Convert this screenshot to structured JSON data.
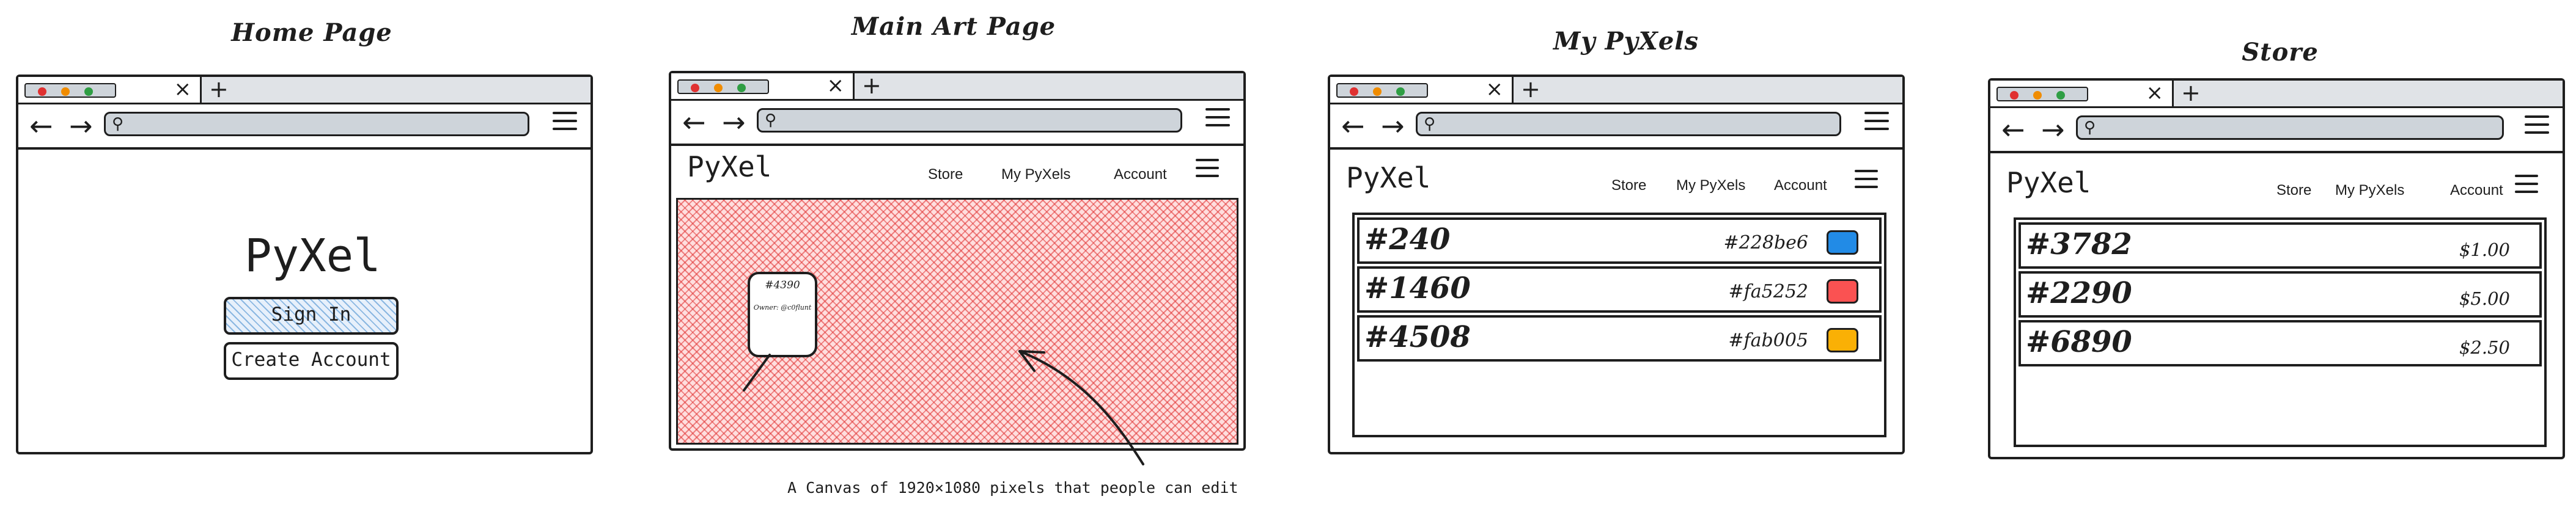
{
  "page_titles": {
    "home": "Home Page",
    "art": "Main Art Page",
    "mypyxels": "My PyXels",
    "store": "Store"
  },
  "brand": "PyXel",
  "nav_menu": {
    "store": "Store",
    "my_pyxels": "My PyXels",
    "account": "Account"
  },
  "browser": {
    "tab_close": "×",
    "new_tab": "+",
    "nav_arrows": "← →",
    "search_icon_glyph": "⚲",
    "dot_colors": [
      "#e03131",
      "#f08c00",
      "#2f9e44"
    ]
  },
  "home": {
    "sign_in": "Sign In",
    "create_account": "Create Account"
  },
  "art": {
    "canvas_color": "#e03131",
    "popup_id": "#4390",
    "popup_owner": "Owner: @c0flunt",
    "caption": "A Canvas of 1920×1080 pixels that people can edit"
  },
  "mypyxels": {
    "items": [
      {
        "id": "#240",
        "hex": "#228be6",
        "color": "#228be6"
      },
      {
        "id": "#1460",
        "hex": "#fa5252",
        "color": "#fa5252"
      },
      {
        "id": "#4508",
        "hex": "#fab005",
        "color": "#fab005"
      }
    ]
  },
  "store": {
    "items": [
      {
        "id": "#3782",
        "price": "$1.00"
      },
      {
        "id": "#2290",
        "price": "$5.00"
      },
      {
        "id": "#6890",
        "price": "$2.50"
      }
    ]
  }
}
